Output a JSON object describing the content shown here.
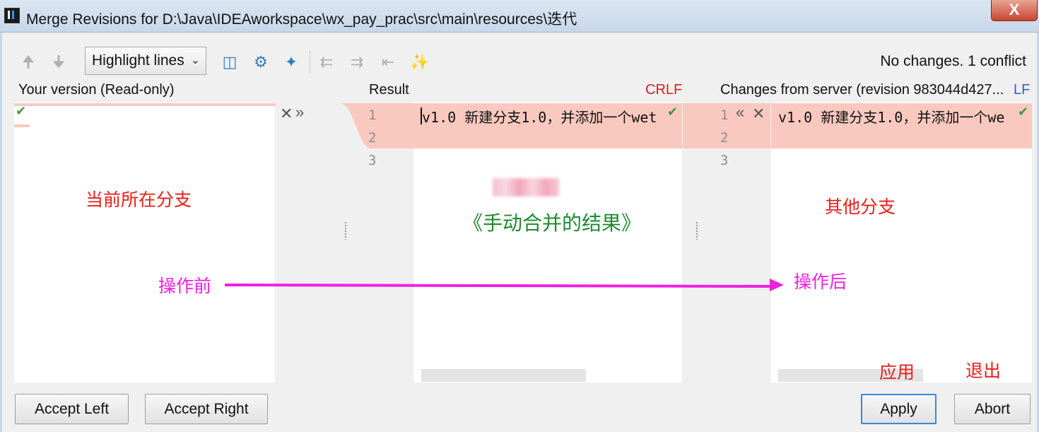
{
  "window": {
    "title": "Merge Revisions for D:\\Java\\IDEAworkspace\\wx_pay_prac\\src\\main\\resources\\迭代",
    "close_glyph": "X"
  },
  "toolbar": {
    "highlight_mode": "Highlight lines",
    "status": "No changes. 1 conflict"
  },
  "headers": {
    "left": "Your version (Read-only)",
    "center": "Result",
    "center_line_ending": "CRLF",
    "right": "Changes from server (revision 983044d427...",
    "right_line_ending": "LF"
  },
  "editor": {
    "line_numbers": [
      "1",
      "2",
      "3"
    ],
    "result_line1": "v1.0  新建分支1.0，并添加一个wet",
    "server_line1": "v1.0  新建分支1.0，并添加一个we"
  },
  "annotations": {
    "current_branch": "当前所在分支",
    "manual_merge_result": "《手动合并的结果》",
    "other_branch": "其他分支",
    "before_operation": "操作前",
    "after_operation": "操作后",
    "apply_note": "应用",
    "exit_note": "退出"
  },
  "buttons": {
    "accept_left": "Accept Left",
    "accept_right": "Accept Right",
    "apply": "Apply",
    "abort": "Abort"
  },
  "colors": {
    "conflict_bg": "#f9c9bf",
    "annotation_red": "#e8201a",
    "annotation_magenta": "#f020e0",
    "annotation_green": "#1f8a2e",
    "accent_blue": "#2f7fc2"
  }
}
